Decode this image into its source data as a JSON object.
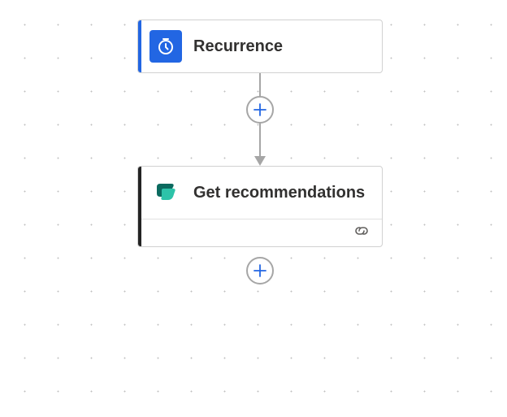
{
  "nodes": [
    {
      "id": "recurrence",
      "title": "Recurrence",
      "accent_color": "#2266e3",
      "icon_bg": "blue",
      "icon_name": "clock-icon",
      "has_footer": false
    },
    {
      "id": "get-recommendations",
      "title": "Get recommendations",
      "accent_color": "#242424",
      "icon_bg": "white",
      "icon_name": "process-advisor-icon",
      "has_footer": true,
      "footer_icon": "link-icon"
    }
  ],
  "add_button_label": "Add step"
}
